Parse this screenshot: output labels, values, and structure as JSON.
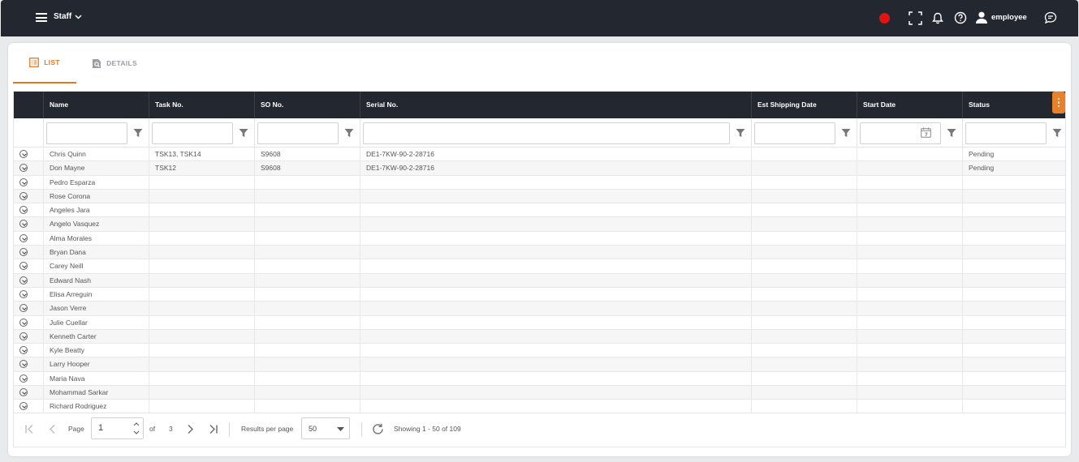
{
  "topbar": {
    "menu_title": "Staff",
    "username": "employee",
    "icons": [
      "record-indicator-icon",
      "scan-icon",
      "bell-icon",
      "help-icon",
      "user-icon",
      "chat-icon"
    ]
  },
  "tabs": [
    {
      "label": "LIST",
      "icon": "list-icon",
      "active": true
    },
    {
      "label": "DETAILS",
      "icon": "details-search-icon",
      "active": false
    }
  ],
  "grid": {
    "columns": [
      "Name",
      "Task No.",
      "SO No.",
      "Serial No.",
      "Est Shipping Date",
      "Start Date",
      "Status"
    ],
    "rows": [
      {
        "name": "Chris Quinn",
        "task": "TSK13, TSK14",
        "so": "S9608",
        "serial": "DE1-7KW-90-2-28716",
        "est": "",
        "start": "",
        "status": "Pending"
      },
      {
        "name": "Don Mayne",
        "task": "TSK12",
        "so": "S9608",
        "serial": "DE1-7KW-90-2-28716",
        "est": "",
        "start": "",
        "status": "Pending"
      },
      {
        "name": "Pedro Esparza",
        "task": "",
        "so": "",
        "serial": "",
        "est": "",
        "start": "",
        "status": ""
      },
      {
        "name": "Rose Corona",
        "task": "",
        "so": "",
        "serial": "",
        "est": "",
        "start": "",
        "status": ""
      },
      {
        "name": "Angeles Jara",
        "task": "",
        "so": "",
        "serial": "",
        "est": "",
        "start": "",
        "status": ""
      },
      {
        "name": "Angelo Vasquez",
        "task": "",
        "so": "",
        "serial": "",
        "est": "",
        "start": "",
        "status": ""
      },
      {
        "name": "Alma Morales",
        "task": "",
        "so": "",
        "serial": "",
        "est": "",
        "start": "",
        "status": ""
      },
      {
        "name": "Bryan Dana",
        "task": "",
        "so": "",
        "serial": "",
        "est": "",
        "start": "",
        "status": ""
      },
      {
        "name": "Carey Neill",
        "task": "",
        "so": "",
        "serial": "",
        "est": "",
        "start": "",
        "status": ""
      },
      {
        "name": "Edward Nash",
        "task": "",
        "so": "",
        "serial": "",
        "est": "",
        "start": "",
        "status": ""
      },
      {
        "name": "Elisa Arreguin",
        "task": "",
        "so": "",
        "serial": "",
        "est": "",
        "start": "",
        "status": ""
      },
      {
        "name": "Jason Verre",
        "task": "",
        "so": "",
        "serial": "",
        "est": "",
        "start": "",
        "status": ""
      },
      {
        "name": "Julie Cuellar",
        "task": "",
        "so": "",
        "serial": "",
        "est": "",
        "start": "",
        "status": ""
      },
      {
        "name": "Kenneth Carter",
        "task": "",
        "so": "",
        "serial": "",
        "est": "",
        "start": "",
        "status": ""
      },
      {
        "name": "Kyle Beatty",
        "task": "",
        "so": "",
        "serial": "",
        "est": "",
        "start": "",
        "status": ""
      },
      {
        "name": "Larry Hooper",
        "task": "",
        "so": "",
        "serial": "",
        "est": "",
        "start": "",
        "status": ""
      },
      {
        "name": "Maria Nava",
        "task": "",
        "so": "",
        "serial": "",
        "est": "",
        "start": "",
        "status": ""
      },
      {
        "name": "Mohammad Sarkar",
        "task": "",
        "so": "",
        "serial": "",
        "est": "",
        "start": "",
        "status": ""
      },
      {
        "name": "Richard Rodriguez",
        "task": "",
        "so": "",
        "serial": "",
        "est": "",
        "start": "",
        "status": ""
      }
    ]
  },
  "pager": {
    "page_label": "Page",
    "page_value": "1",
    "of_label": "of",
    "total_pages": "3",
    "results_label": "Results per page",
    "per_page": "50",
    "showing": "Showing 1 - 50 of 109"
  },
  "colors": {
    "accent": "#e07a25",
    "header_bg": "#232730",
    "record": "#e21313"
  }
}
